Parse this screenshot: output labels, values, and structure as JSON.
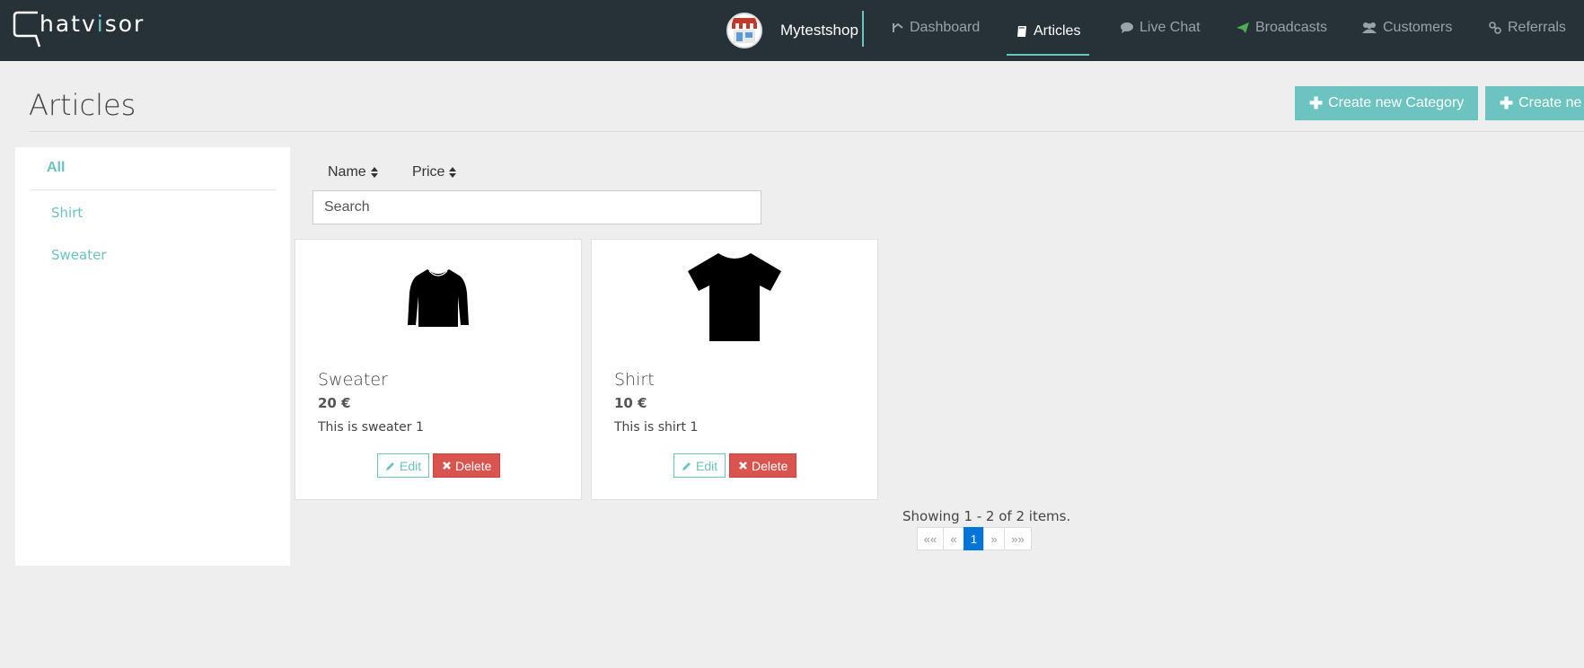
{
  "app": {
    "logo_prefix": "hatv",
    "logo_accent": "i",
    "logo_suffix": "sor",
    "shop_name": "Mytestshop",
    "accent_color": "#6cc3c0",
    "topbar_color": "#263238"
  },
  "nav": {
    "items": [
      {
        "label": "Dashboard",
        "icon": "dashboard-icon"
      },
      {
        "label": "Articles",
        "icon": "book-icon",
        "active": true
      },
      {
        "label": "Live Chat",
        "icon": "chat-bubble-icon"
      },
      {
        "label": "Broadcasts",
        "icon": "paper-plane-icon"
      },
      {
        "label": "Customers",
        "icon": "users-icon"
      },
      {
        "label": "Referrals",
        "icon": "link-icon"
      }
    ]
  },
  "page": {
    "title": "Articles",
    "create_category_label": "Create new Category",
    "create_article_label": "Create ne"
  },
  "sidebar": {
    "items": [
      {
        "label": "All",
        "active": true
      },
      {
        "label": "Shirt"
      },
      {
        "label": "Sweater"
      }
    ]
  },
  "sort": {
    "name_label": "Name",
    "price_label": "Price"
  },
  "search": {
    "placeholder": "Search"
  },
  "articles": [
    {
      "title": "Sweater",
      "price": "20 €",
      "description": "This is sweater 1",
      "image": "sweater-icon",
      "edit_label": "Edit",
      "delete_label": "Delete"
    },
    {
      "title": "Shirt",
      "price": "10 €",
      "description": "This is shirt 1",
      "image": "tshirt-icon",
      "edit_label": "Edit",
      "delete_label": "Delete"
    }
  ],
  "pagination": {
    "summary": "Showing 1 - 2 of 2 items.",
    "first": "««",
    "prev": "«",
    "current": "1",
    "next": "»",
    "last": "»»"
  }
}
